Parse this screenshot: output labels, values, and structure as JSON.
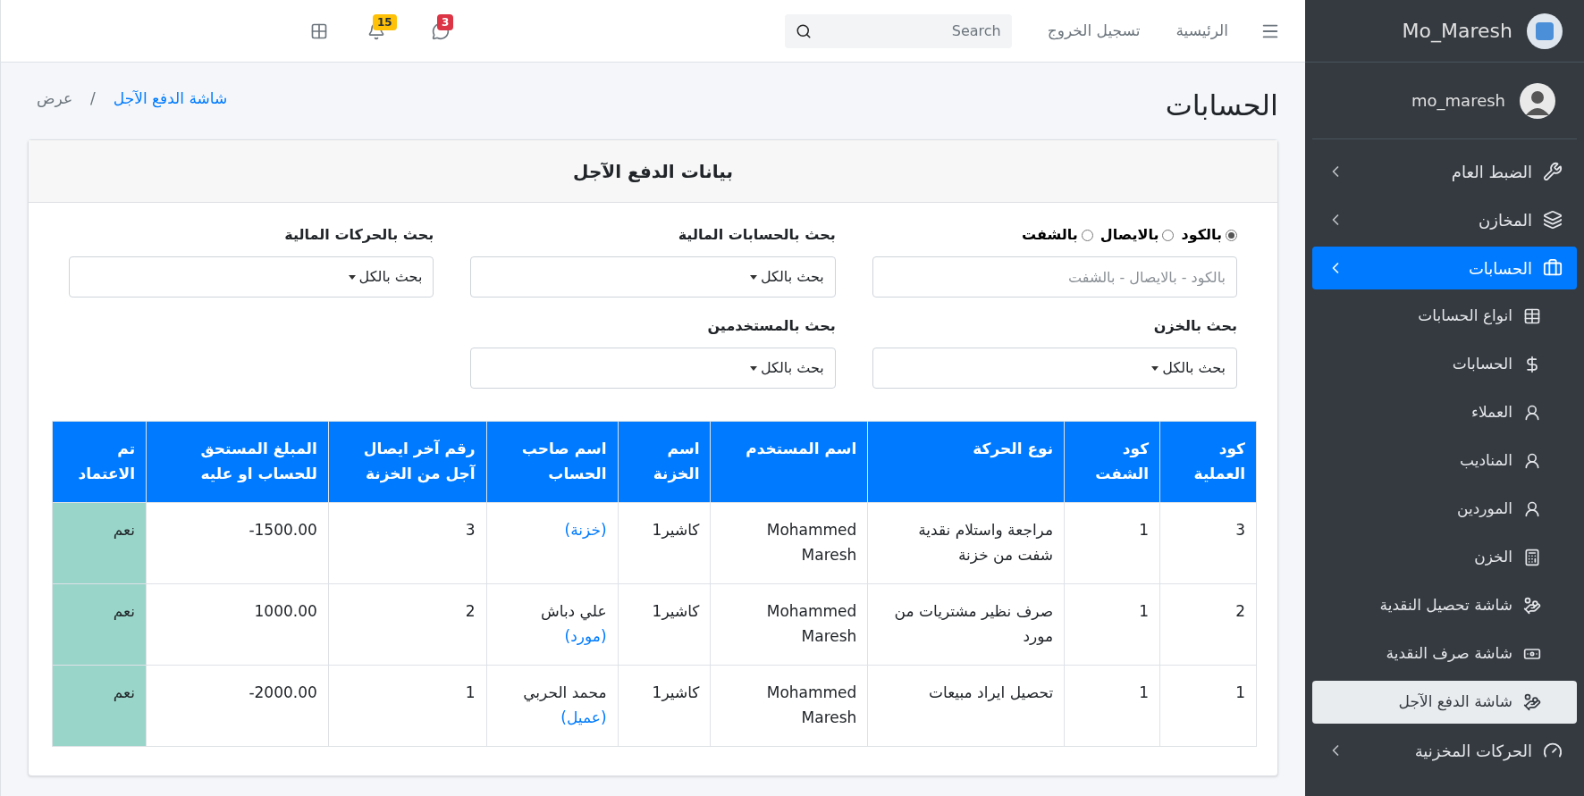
{
  "navbar": {
    "links": [
      "الرئيسية",
      "تسجيل الخروج"
    ],
    "search": {
      "placeholder": "Search"
    },
    "badges": [
      {
        "count": "3",
        "color": "#dc3545"
      },
      {
        "count": "15",
        "color": "#ffc107"
      }
    ]
  },
  "sidebar": {
    "brand": "Mo_Maresh",
    "user": "mo_maresh",
    "items": [
      {
        "label": "الضبط العام",
        "expanded": false
      },
      {
        "label": "المخازن",
        "expanded": false
      },
      {
        "label": "الحسابات",
        "expanded": true,
        "children": [
          {
            "label": "انواع الحسابات",
            "selected": false
          },
          {
            "label": "الحسابات",
            "selected": false
          },
          {
            "label": "العملاء",
            "selected": false
          },
          {
            "label": "المناديب",
            "selected": false
          },
          {
            "label": "الموردين",
            "selected": false
          },
          {
            "label": "الخزن",
            "selected": false
          },
          {
            "label": "شاشة تحصيل النقدية",
            "selected": false
          },
          {
            "label": "شاشة صرف النقدية",
            "selected": false
          },
          {
            "label": "شاشة الدفع الآجل",
            "selected": true
          }
        ]
      },
      {
        "label": "الحركات المخزنية",
        "expanded": false
      }
    ]
  },
  "page": {
    "title": "الحسابات",
    "breadcrumb": [
      {
        "label": "شاشة الدفع الآجل",
        "kind": "link"
      },
      {
        "label": "/",
        "kind": "separator"
      },
      {
        "label": "عرض",
        "kind": "current"
      }
    ]
  },
  "card": {
    "title": "بيانات الدفع الآجل",
    "search": {
      "options": [
        {
          "label": "بالكود",
          "selected": true
        },
        {
          "label": "بالايصال",
          "selected": false
        },
        {
          "label": "بالشفت",
          "selected": false
        }
      ],
      "placeholder": "بالكود - بالايصال - بالشفت"
    },
    "selects": [
      {
        "label": "بحث بالحسابات المالية",
        "value": "بحث بالكل"
      },
      {
        "label": "بحث بالحركات المالية",
        "value": "بحث بالكل"
      },
      {
        "label": "بحث بالخزن",
        "value": "بحث بالكل"
      },
      {
        "label": "بحث بالمستخدمين",
        "value": "بحث بالكل"
      }
    ],
    "table": {
      "columns": [
        "كود العملية",
        "كود الشفت",
        "نوع الحركة",
        "اسم المستخدم",
        "اسم الخزنة",
        "اسم صاحب الحساب",
        "رقم آخر ايصال آجل من الخزنة",
        "المبلغ المستحق للحساب او عليه",
        "تم الاعتماد"
      ],
      "rows": [
        {
          "op_code": "3",
          "shift_code": "1",
          "movement": "مراجعة واستلام نقدية شفت من خزنة",
          "user": "Mohammed Maresh",
          "treasury": "كاشير1",
          "holder_type": "(خزنة)",
          "receipt": "3",
          "amount": "-1500.00",
          "approved": "نعم"
        },
        {
          "op_code": "2",
          "shift_code": "1",
          "movement": "صرف نظير مشتريات من مورد",
          "user": "Mohammed Maresh",
          "treasury": "كاشير1",
          "holder_name": "علي دباش",
          "holder_type": "(مورد)",
          "receipt": "2",
          "amount": "1000.00",
          "approved": "نعم"
        },
        {
          "op_code": "1",
          "shift_code": "1",
          "movement": "تحصيل ايراد مبيعات",
          "user": "Mohammed Maresh",
          "treasury": "كاشير1",
          "holder_name": "محمد الحربي",
          "holder_type": "(عميل)",
          "receipt": "1",
          "amount": "-2000.00",
          "approved": "نعم"
        }
      ]
    }
  }
}
